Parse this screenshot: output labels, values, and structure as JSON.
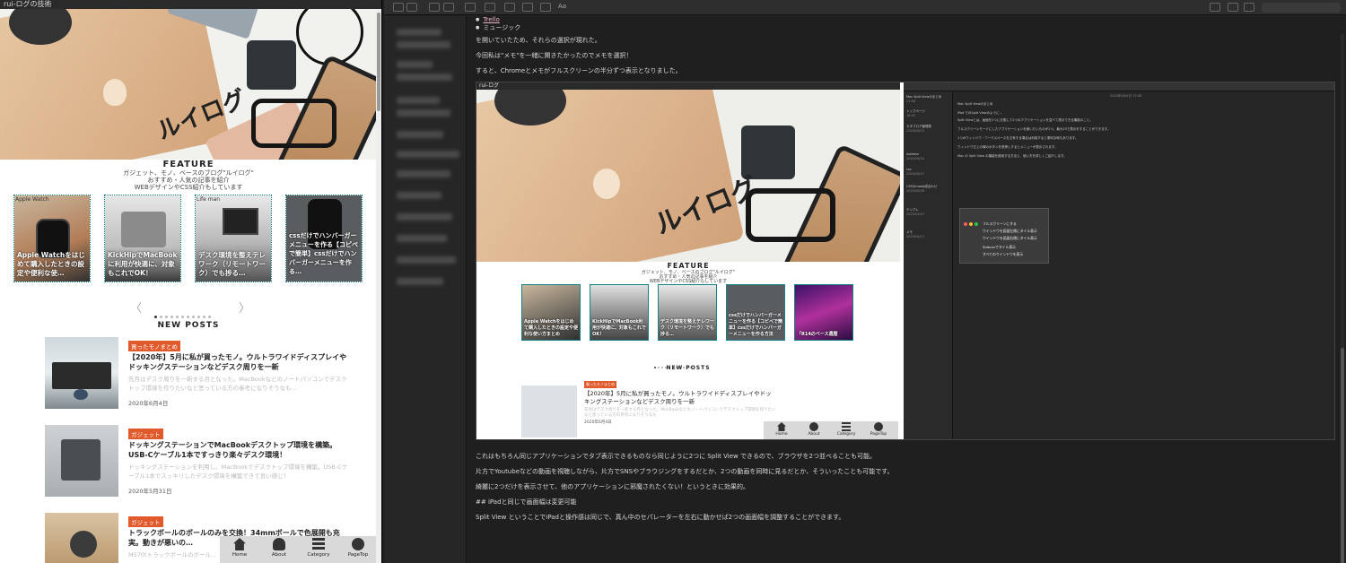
{
  "left_window": {
    "title": "rui-ログの技術",
    "hero_logo": "ルイログ",
    "feature": {
      "heading": "FEATURE",
      "sub1": "ガジェット、モノ、ベースのブログ\"ルイログ\"",
      "sub2": "おすすめ・人気の記事を紹介",
      "sub3": "WEBデザインやCSS紹介もしています"
    },
    "cards": [
      {
        "tag": "Apple Watch",
        "caption": "Apple Watchをはじめて購入したときの設定や便利な使…"
      },
      {
        "tag": "",
        "caption": "KickHipでMacBookに利用が快適に、対象もこれでOK！"
      },
      {
        "tag": "Life man",
        "caption": "デスク環境を整えテレワーク（リモートワーク）でも捗る…"
      },
      {
        "tag": "",
        "caption": "cssだけでハンバーガーメニューを作る【コピペで簡単】cssだけでハンバーガーメニューを作る…"
      }
    ],
    "pager": {
      "prev": "〈",
      "next": "〉"
    },
    "new_posts_heading": "NEW POSTS",
    "posts": [
      {
        "badge": "買ったモノまとめ",
        "title": "【2020年】5月に私が買ったモノ。ウルトラワイドディスプレイやドッキングステーションなどデスク周りを一新",
        "excerpt": "先月はデスク周りを一新する月となった。MacBookなどのノートパソコンでデスクトップ環境を作りたいなと思っている方の参考になりそうなも…",
        "date": "2020年6月4日"
      },
      {
        "badge": "ガジェット",
        "title": "ドッキングステーションでMacBookデスクトップ環境を構築。USB-Cケーブル1本ですっきり楽々デスク環境！",
        "excerpt": "ドッキングステーションを利用し、MacBookでデスクトップ環境を構築。USB-Cケーブル1本でスッキリしたデスク環境を構築できて良い感じ！",
        "date": "2020年5月31日"
      },
      {
        "badge": "ガジェット",
        "title": "トラックボールのボールのみを交換！34mmボールで色展開も充実。動きが悪いの…",
        "excerpt": "M570tトラックボールのボール…",
        "date": ""
      }
    ],
    "bottom_nav": [
      {
        "label": "Home"
      },
      {
        "label": "About"
      },
      {
        "label": "Category"
      },
      {
        "label": "PageTop"
      }
    ]
  },
  "right_window": {
    "toolbar_label": "Aa",
    "search_placeholder": "",
    "editor": {
      "link_item": "Trello",
      "list_item": "ミュージック",
      "para1": "を開いていたため、それらの選択が現れた。",
      "para2": "今回私は\"メモ\"を一緒に開きたかったのでメモを選択！",
      "para3": "すると、Chromeとメモがフルスクリーンの半分ずつ表示となりました。",
      "para4": "これはもちろん同じアプリケーションでタブ表示できるものなら同じように2つに Split View できるので、ブラウザを2つ並べることも可能。",
      "para5": "片方でYoutubeなどの動画を視聴しながら、片方でSNSやブラウジングをするだとか、2つの動画を同時に見るだとか、そういったことも可能です。",
      "para6": "綺麗に2つだけを表示させて、他のアプリケーションに邪魔されたくない！というときに効果的。",
      "para7": "## iPadと同じで画面幅は変更可能",
      "para8": "Split View ということでiPadと操作感は同じで、真ん中のセパレーターを左右に動かせば2つの画面幅を調整することができます。"
    },
    "embedded": {
      "left_title": "rui-ログ",
      "feature_heading": "FEATURE",
      "feature_sub1": "ガジェット、モノ、ベースのブログ\"ルイログ\"",
      "feature_sub2": "おすすめ・人気の記事を紹介",
      "feature_sub3": "WEBデザインやCSS紹介もしています",
      "cards": [
        {
          "caption": "Apple Watchをはじめて購入したときの設定や便利な使い方まとめ"
        },
        {
          "caption": "KickHipでMacBook利用が快適に、対象もこれでOK！"
        },
        {
          "caption": "デスク環境を整えテレワーク（リモートワーク）でも捗る…"
        },
        {
          "caption": "cssだけでハンバーガーメニューを作る【コピペで簡単】cssだけでハンバーガーメニューを作る方法"
        },
        {
          "caption": "「R14のベース選歴"
        }
      ],
      "new_posts_heading": "NEW POSTS",
      "post_badge": "買ったモノまとめ",
      "post_title": "【2020年】5月に私が買ったモノ。ウルトラワイドディスプレイやドッキングステーションなどデスク周りを一新",
      "post_excerpt": "先月はデスク周りを一新する月となった。MacBookなどのノートパソコンでデスクトップ環境を作りたいなと思っている方の参考になりそうなも",
      "post_date": "2020年6月4日",
      "nav": [
        "Home",
        "About",
        "Category",
        "PageTop"
      ],
      "notes_header": "2020年6月4日 17:08",
      "notes": [
        {
          "title": "Mac Split Viewのまとめ",
          "date": "21:58"
        },
        {
          "title": "トップページ",
          "date": "18:32"
        },
        {
          "title": "ネタブログ管理表",
          "date": "2020/06/13"
        },
        {
          "title": "Address",
          "date": "2020/06/24"
        },
        {
          "title": "css",
          "date": "2020/06/27"
        },
        {
          "title": "CSSのmoda成合わせ",
          "date": "2020/06/26"
        },
        {
          "title": "メモ",
          "date": "2020/04/17"
        },
        {
          "title": "テンプレ",
          "date": "2020/04/07"
        }
      ],
      "note_lines": [
        "Mac Split Viewのまとめ",
        "iPad でのSplit Viewのように…",
        "Split Viewとは、画面を2つに分割して2つのアプリケーションを並べて表示できる機能のこと。",
        "フルスクリーンモードにしたアプリケーションを使いたいものが2つ、最大20で表示をすることができます。",
        "1つのウィンドウ・ワークスペースを占有する場合は利用すると便利な時もあります。",
        "ウィンドウ左上の緑のボタンを長押しするとメニューが表示されます。",
        "Mac の Split View の機能を使用する方法と、使い方を詳しくご紹介します。"
      ],
      "menu_items": [
        "フルスクリーンにする",
        "ウインドウを画面左側にタイル表示",
        "ウインドウを画面右側にタイル表示",
        "Sidecarでタイル表示",
        "すべてのウインドウを表示"
      ]
    }
  }
}
